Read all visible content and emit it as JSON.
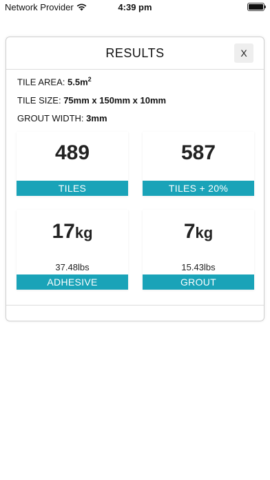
{
  "status": {
    "carrier": "Network Provider",
    "time": "4:39 pm"
  },
  "modal": {
    "title": "RESULTS",
    "close_label": "X",
    "tile_area": {
      "label": "TILE AREA:",
      "value": "5.5m",
      "superscript": "2"
    },
    "tile_size": {
      "label": "TILE SIZE:",
      "value": "75mm x 150mm x 10mm"
    },
    "grout_width": {
      "label": "GROUT WIDTH:",
      "value": "3mm"
    },
    "cards": {
      "tiles": {
        "value": "489",
        "label": "TILES"
      },
      "tiles_extra": {
        "value": "587",
        "label": "TILES + 20%"
      },
      "adhesive": {
        "value": "17",
        "unit": "kg",
        "sub": "37.48lbs",
        "label": "ADHESIVE"
      },
      "grout": {
        "value": "7",
        "unit": "kg",
        "sub": "15.43lbs",
        "label": "GROUT"
      }
    }
  },
  "colors": {
    "accent": "#1aa3b8"
  },
  "icons": [
    "wifi-icon",
    "battery-icon"
  ]
}
